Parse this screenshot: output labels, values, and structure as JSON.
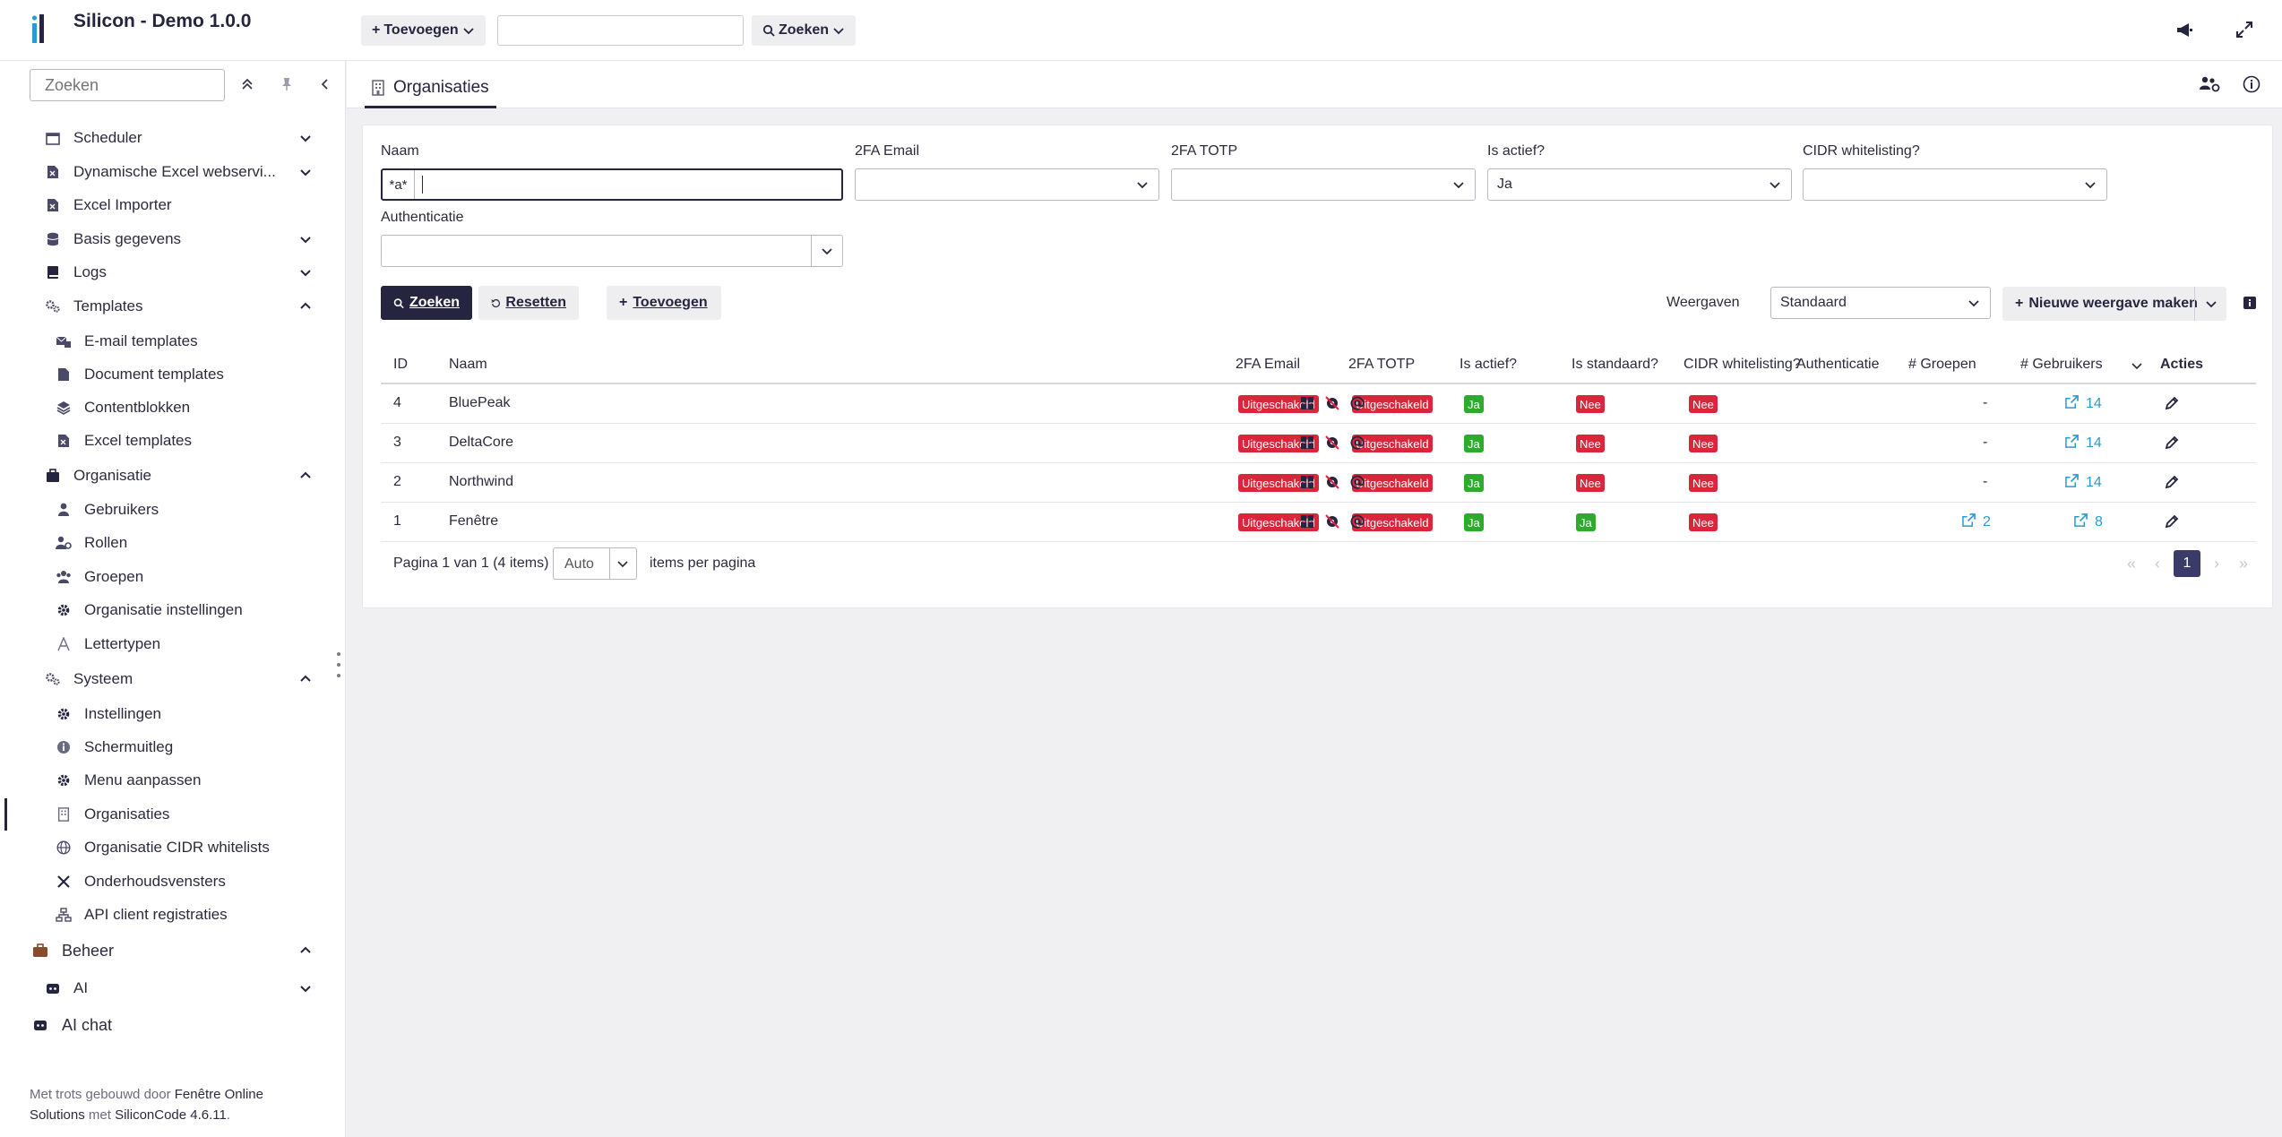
{
  "header": {
    "title": "Silicon - Demo 1.0.0",
    "add_label": "Toevoegen",
    "search_value": "",
    "search_label": "Zoeken"
  },
  "sidebar": {
    "search_placeholder": "Zoeken",
    "items": [
      {
        "label": "Scheduler",
        "level": 1,
        "icon": "calendar-icon",
        "chevron": "down"
      },
      {
        "label": "Dynamische Excel webservi...",
        "level": 1,
        "icon": "excel-file-icon",
        "chevron": "down"
      },
      {
        "label": "Excel Importer",
        "level": 1,
        "icon": "excel-file-icon",
        "chevron": ""
      },
      {
        "label": "Basis gegevens",
        "level": 1,
        "icon": "database-icon",
        "chevron": "down"
      },
      {
        "label": "Logs",
        "level": 1,
        "icon": "book-icon",
        "chevron": "down"
      },
      {
        "label": "Templates",
        "level": 1,
        "icon": "cogs-icon",
        "chevron": "up"
      },
      {
        "label": "E-mail templates",
        "level": 2,
        "icon": "mail-template-icon",
        "chevron": ""
      },
      {
        "label": "Document templates",
        "level": 2,
        "icon": "document-icon",
        "chevron": ""
      },
      {
        "label": "Contentblokken",
        "level": 2,
        "icon": "layers-icon",
        "chevron": ""
      },
      {
        "label": "Excel templates",
        "level": 2,
        "icon": "excel-file-icon",
        "chevron": ""
      },
      {
        "label": "Organisatie",
        "level": 1,
        "icon": "briefcase-icon",
        "chevron": "up"
      },
      {
        "label": "Gebruikers",
        "level": 2,
        "icon": "user-icon",
        "chevron": ""
      },
      {
        "label": "Rollen",
        "level": 2,
        "icon": "user-gear-icon",
        "chevron": ""
      },
      {
        "label": "Groepen",
        "level": 2,
        "icon": "users-icon",
        "chevron": ""
      },
      {
        "label": "Organisatie instellingen",
        "level": 2,
        "icon": "gear-icon",
        "chevron": ""
      },
      {
        "label": "Lettertypen",
        "level": 2,
        "icon": "font-icon",
        "chevron": ""
      },
      {
        "label": "Systeem",
        "level": 1,
        "icon": "cogs-icon",
        "chevron": "up"
      },
      {
        "label": "Instellingen",
        "level": 2,
        "icon": "gear-icon",
        "chevron": ""
      },
      {
        "label": "Schermuitleg",
        "level": 2,
        "icon": "info-icon",
        "chevron": ""
      },
      {
        "label": "Menu aanpassen",
        "level": 2,
        "icon": "gear-icon",
        "chevron": ""
      },
      {
        "label": "Organisaties",
        "level": 2,
        "icon": "building-icon",
        "chevron": "",
        "active": true
      },
      {
        "label": "Organisatie CIDR whitelists",
        "level": 2,
        "icon": "globe-icon",
        "chevron": ""
      },
      {
        "label": "Onderhoudsvensters",
        "level": 2,
        "icon": "tools-icon",
        "chevron": ""
      },
      {
        "label": "API client registraties",
        "level": 2,
        "icon": "sitemap-icon",
        "chevron": ""
      },
      {
        "label": "Beheer",
        "level": 0,
        "icon": "suitcase-icon",
        "chevron": "up"
      },
      {
        "label": "AI",
        "level": 1,
        "icon": "robot-icon",
        "chevron": "down"
      },
      {
        "label": "AI chat",
        "level": 0,
        "icon": "robot-icon",
        "chevron": ""
      }
    ],
    "footer": {
      "prefix": "Met trots gebouwd door ",
      "company": "Fenêtre Online Solutions",
      "middle": " met ",
      "product": "SiliconCode 4.6.11",
      "suffix": "."
    }
  },
  "tabs": [
    {
      "label": "Organisaties",
      "icon": "building-icon"
    }
  ],
  "filters": {
    "naam_label": "Naam",
    "naam_prefix": "*a*",
    "naam_value": "",
    "email2fa_label": "2FA Email",
    "email2fa_value": "",
    "totp_label": "2FA TOTP",
    "totp_value": "",
    "actief_label": "Is actief?",
    "actief_value": "Ja",
    "cidr_label": "CIDR whitelisting?",
    "cidr_value": "",
    "auth_label": "Authenticatie",
    "auth_value": ""
  },
  "actions": {
    "search": "Zoeken",
    "reset": "Resetten",
    "add": "Toevoegen",
    "views_label": "Weergaven",
    "views_value": "Standaard",
    "new_view": "Nieuwe weergave maken"
  },
  "table": {
    "columns": [
      "ID",
      "Naam",
      "2FA Email",
      "2FA TOTP",
      "Is actief?",
      "Is standaard?",
      "CIDR whitelisting?",
      "Authenticatie",
      "# Groepen",
      "# Gebruikers",
      "Acties"
    ],
    "rows": [
      {
        "id": "4",
        "naam": "BluePeak",
        "email2fa": "Uitgeschakeld",
        "totp": "Uitgeschakeld",
        "actief": "Ja",
        "standaard": "Nee",
        "cidr": "Nee",
        "groepen": "-",
        "gebruikers": "14"
      },
      {
        "id": "3",
        "naam": "DeltaCore",
        "email2fa": "Uitgeschakeld",
        "totp": "Uitgeschakeld",
        "actief": "Ja",
        "standaard": "Nee",
        "cidr": "Nee",
        "groepen": "-",
        "gebruikers": "14"
      },
      {
        "id": "2",
        "naam": "Northwind",
        "email2fa": "Uitgeschakeld",
        "totp": "Uitgeschakeld",
        "actief": "Ja",
        "standaard": "Nee",
        "cidr": "Nee",
        "groepen": "-",
        "gebruikers": "14"
      },
      {
        "id": "1",
        "naam": "Fenêtre",
        "email2fa": "Uitgeschakeld",
        "totp": "Uitgeschakeld",
        "actief": "Ja",
        "standaard": "Ja",
        "cidr": "Nee",
        "groepen": "2",
        "gebruikers": "8"
      }
    ]
  },
  "pager": {
    "summary": "Pagina 1 van 1  (4 items)",
    "per_page_value": "Auto",
    "per_page_label": "items per pagina",
    "current_page": "1"
  },
  "colors": {
    "primary": "#252540",
    "danger": "#d9263b",
    "success": "#2eab2e",
    "link": "#2a9bd0"
  }
}
